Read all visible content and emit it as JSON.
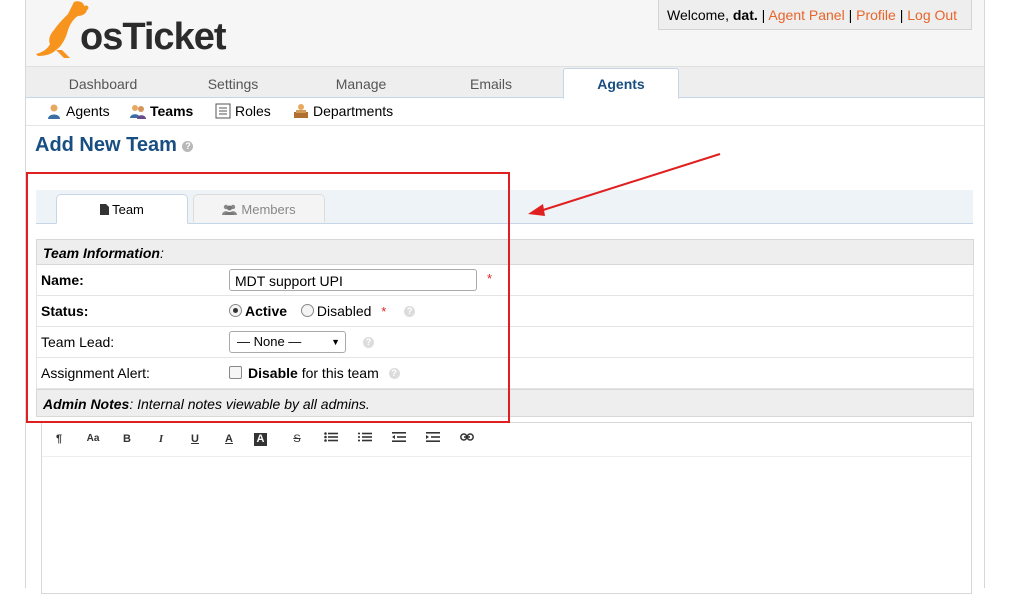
{
  "header": {
    "welcome_prefix": "Welcome,",
    "username": "dat.",
    "links": [
      "Agent Panel",
      "Profile",
      "Log Out"
    ],
    "separator": "|"
  },
  "nav": {
    "tabs": [
      "Dashboard",
      "Settings",
      "Manage",
      "Emails",
      "Agents"
    ],
    "active": "Agents"
  },
  "subnav": {
    "items": [
      {
        "label": "Agents",
        "icon": "agent-icon"
      },
      {
        "label": "Teams",
        "icon": "teams-icon"
      },
      {
        "label": "Roles",
        "icon": "roles-icon"
      },
      {
        "label": "Departments",
        "icon": "departments-icon"
      }
    ],
    "active": "Teams"
  },
  "page": {
    "title": "Add New Team",
    "help": "?"
  },
  "tabs": {
    "team": "Team",
    "members": "Members"
  },
  "form": {
    "section_title": "Team Information",
    "section_suffix": ":",
    "name_label": "Name:",
    "name_value": "MDT support UPI",
    "required_mark": "*",
    "status_label": "Status:",
    "status_active": "Active",
    "status_disabled": "Disabled",
    "lead_label": "Team Lead:",
    "lead_value": "— None —",
    "alert_label": "Assignment Alert:",
    "alert_bold": "Disable",
    "alert_rest": "for this team",
    "notes_title": "Admin Notes",
    "notes_desc": ": Internal notes viewable by all admins."
  },
  "editor": {
    "toolbar": [
      "¶",
      "Aa",
      "B",
      "I",
      "U",
      "A",
      "A",
      "S",
      "list-ul",
      "list-ol",
      "outdent",
      "indent",
      "link"
    ]
  },
  "logo": {
    "wordmark": "osTicket"
  },
  "colors": {
    "accent_link": "#e8652a",
    "title_blue": "#184e81",
    "annotation_red": "#e02020"
  }
}
